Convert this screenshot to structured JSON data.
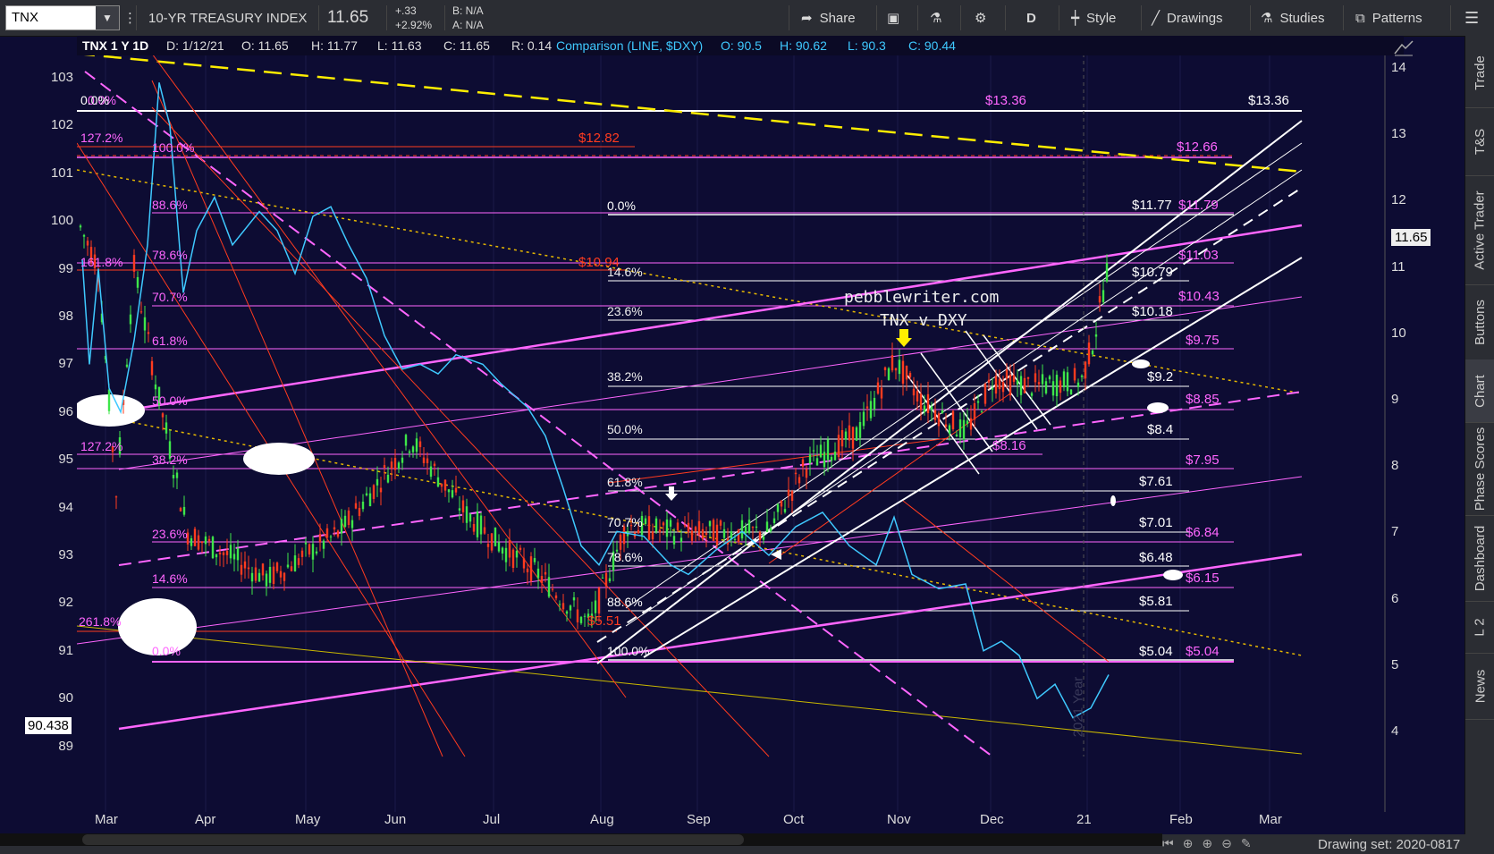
{
  "toolbar": {
    "symbol": "TNX",
    "description": "10-YR TREASURY INDEX",
    "last_price": "11.65",
    "change": "+.33",
    "change_pct": "+2.92%",
    "bid": "B: N/A",
    "ask": "A: N/A",
    "share_label": "Share",
    "timeframe": "D",
    "style_label": "Style",
    "drawings_label": "Drawings",
    "studies_label": "Studies",
    "patterns_label": "Patterns"
  },
  "status_bar": {
    "title": "TNX 1 Y 1D",
    "date": "D: 1/12/21",
    "open": "O: 11.65",
    "high": "H: 11.77",
    "low": "L: 11.63",
    "close": "C: 11.65",
    "range": "R: 0.14",
    "comparison": "Comparison (LINE, $DXY)",
    "cmp_open": "O: 90.5",
    "cmp_high": "H: 90.62",
    "cmp_low": "L: 90.3",
    "cmp_close": "C: 90.44"
  },
  "right_tabs": [
    "Trade",
    "T&S",
    "Active Trader",
    "Buttons",
    "Chart",
    "Phase Scores",
    "Dashboard",
    "L 2",
    "News"
  ],
  "left_axis": [
    "103",
    "102",
    "101",
    "100",
    "99",
    "98",
    "97",
    "96",
    "95",
    "94",
    "93",
    "92",
    "91",
    "90",
    "89"
  ],
  "right_axis": [
    "14",
    "13",
    "12",
    "11",
    "10",
    "9",
    "8",
    "7",
    "6",
    "5",
    "4"
  ],
  "x_axis": [
    "Mar",
    "Apr",
    "May",
    "Jun",
    "Jul",
    "Aug",
    "Sep",
    "Oct",
    "Nov",
    "Dec",
    "21",
    "Feb",
    "Mar"
  ],
  "current_price_tag": "11.65",
  "left_price_tag": "90.438",
  "annotation": {
    "line1": "pebblewriter.com",
    "line2": "TNX v DXY"
  },
  "fib_left": [
    "0.0%",
    "100.0%",
    "88.6%",
    "78.6%",
    "70.7%",
    "61.8%",
    "50.0%",
    "38.2%",
    "23.6%",
    "14.6%",
    "0.0%"
  ],
  "fib_left_red": [
    "0.0%",
    "127.2%",
    "161.8%",
    "127.2%",
    "261.8%"
  ],
  "fib_mid": [
    "0.0%",
    "14.6%",
    "23.6%",
    "38.2%",
    "50.0%",
    "61.8%",
    "70.7%",
    "78.6%",
    "88.6%",
    "100.0%"
  ],
  "price_white": [
    "$13.36",
    "$11.77",
    "$10.79",
    "$10.18",
    "$9.2",
    "$8.4",
    "$7.61",
    "$7.01",
    "$6.48",
    "$5.81",
    "$5.04"
  ],
  "price_magenta": [
    "$13.36",
    "$12.66",
    "$11.79",
    "$11.03",
    "$10.43",
    "$9.75",
    "$8.85",
    "$8.16",
    "$7.95",
    "$6.84",
    "$6.15",
    "$5.04"
  ],
  "price_red": [
    "$12.82",
    "$10.94",
    "$5.51"
  ],
  "year_watermark": "2021 Year",
  "drawing_set": "Drawing set: 2020-0817",
  "colors": {
    "background": "#0d0c33",
    "magenta": "#ff66ff",
    "red": "#ff3b1f",
    "yellow": "#ffee00",
    "cyan": "#3fc9ff",
    "white": "#ffffff"
  }
}
